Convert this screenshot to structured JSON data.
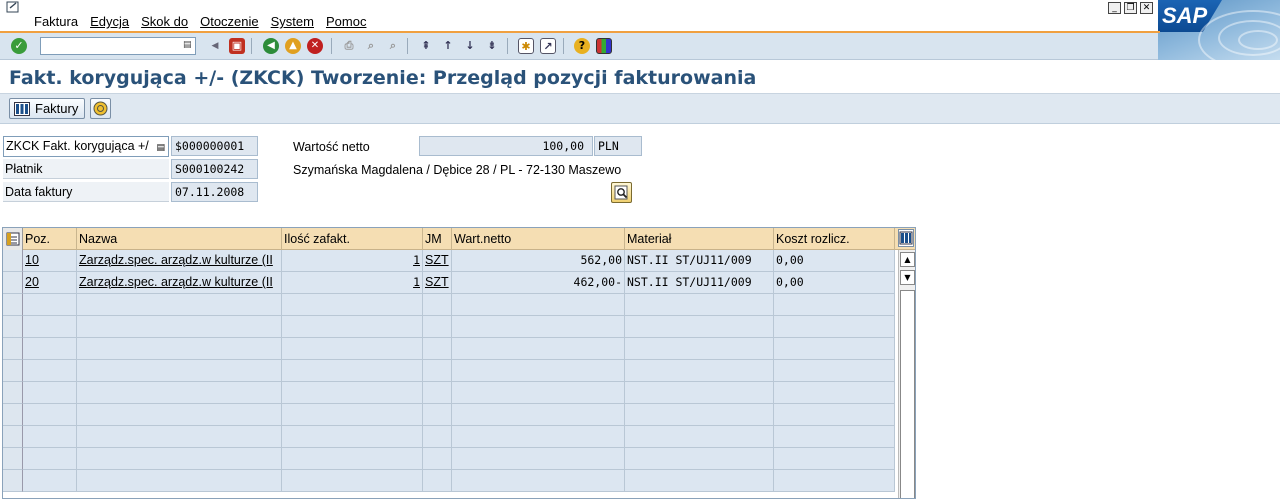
{
  "menu": {
    "items": [
      "Faktura",
      "Edycja",
      "Skok do",
      "Otoczenie",
      "System",
      "Pomoc"
    ]
  },
  "window_buttons": {
    "minimize": "_",
    "restore": "❐",
    "close": "✕"
  },
  "logo": {
    "text": "SAP"
  },
  "toolbar": {
    "command_field_value": "",
    "icons": [
      "enter-icon",
      "back-icon",
      "exit-icon",
      "cancel-icon",
      "print-icon",
      "find-icon",
      "find-next-icon",
      "first-page-icon",
      "previous-page-icon",
      "next-page-icon",
      "last-page-icon",
      "new-session-icon",
      "shortcut-icon",
      "help-icon",
      "layout-icon"
    ]
  },
  "title": "Fakt. korygująca +/-  (ZKCK) Tworzenie: Przegląd pozycji fakturowania",
  "app_toolbar": {
    "faktury_label": "Faktury"
  },
  "header": {
    "doc_type": "ZKCK Fakt. korygująca +/",
    "doc_number": "$000000001",
    "net_value_label": "Wartość netto",
    "net_value": "100,00",
    "currency": "PLN",
    "payer_label": "Płatnik",
    "payer": "S000100242",
    "payer_address": "Szymańska Magdalena / Dębice 28 / PL - 72-130 Maszewo",
    "date_label": "Data faktury",
    "date": "07.11.2008"
  },
  "table": {
    "columns": [
      "Poz.",
      "Nazwa",
      "Ilość zafakt.",
      "JM",
      "Wart.netto",
      "Materiał",
      "Koszt rozlicz."
    ],
    "rows": [
      {
        "pos": "10",
        "name": "Zarządz.spec. arządz.w kulturze (II",
        "qty": "1",
        "uom": "SZT",
        "net": "562,00",
        "material": "NST.II ST/UJ11/009",
        "cost": "0,00"
      },
      {
        "pos": "20",
        "name": "Zarządz.spec. arządz.w kulturze (II",
        "qty": "1",
        "uom": "SZT",
        "net": "462,00-",
        "material": "NST.II ST/UJ11/009",
        "cost": "0,00"
      }
    ],
    "empty_rows": 9
  },
  "colors": {
    "accent_title": "#2a5279",
    "toolbar_bg": "#d8e4ef",
    "table_header_bg": "#f5deb3",
    "cell_bg": "#dce6f1",
    "orange_line": "#f0a040"
  }
}
